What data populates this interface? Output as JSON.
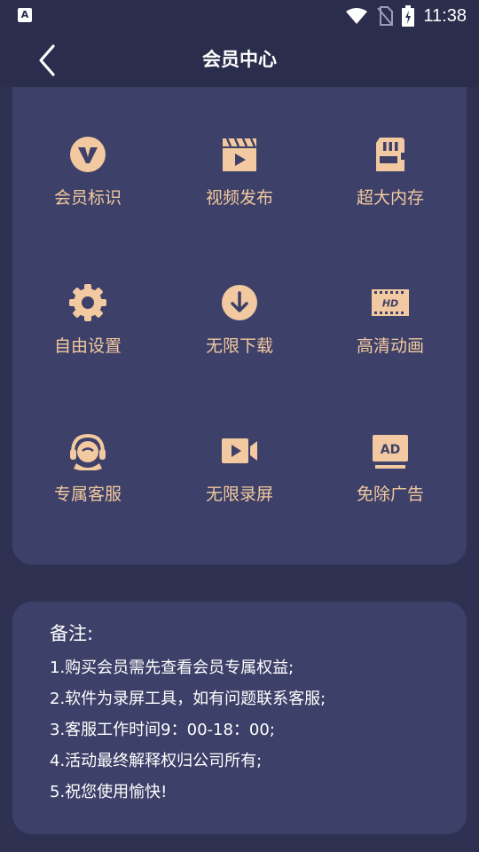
{
  "status_bar": {
    "time": "11:38",
    "left_icon_letter": "A"
  },
  "header": {
    "title": "会员中心"
  },
  "features": [
    {
      "label": "会员标识",
      "icon": "vip-v-icon"
    },
    {
      "label": "视频发布",
      "icon": "video-clapper-icon"
    },
    {
      "label": "超大内存",
      "icon": "sd-card-icon"
    },
    {
      "label": "自由设置",
      "icon": "gear-icon"
    },
    {
      "label": "无限下载",
      "icon": "download-icon"
    },
    {
      "label": "高清动画",
      "icon": "hd-film-icon"
    },
    {
      "label": "专属客服",
      "icon": "headset-icon"
    },
    {
      "label": "无限录屏",
      "icon": "video-camera-icon"
    },
    {
      "label": "免除广告",
      "icon": "ad-icon"
    }
  ],
  "notes": {
    "title": "备注:",
    "items": [
      "1.购买会员需先查看会员专属权益;",
      "2.软件为录屏工具，如有问题联系客服;",
      "3.客服工作时间9：00-18：00;",
      "4.活动最终解释权归公司所有;",
      "5.祝您使用愉快!"
    ]
  },
  "colors": {
    "background": "#2f3153",
    "card": "#3d4068",
    "accent": "#f2c9a0"
  }
}
